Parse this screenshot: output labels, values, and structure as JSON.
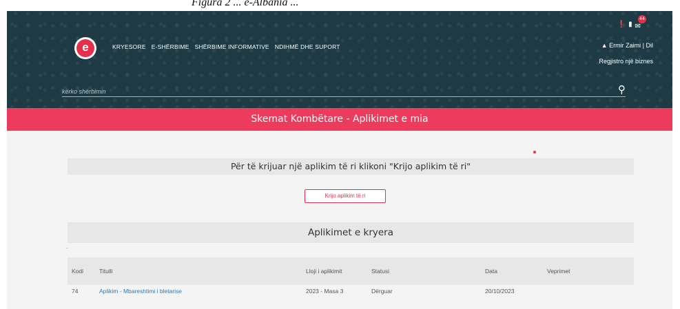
{
  "caption": "Figura 2 ... e-Albania ...",
  "header": {
    "logo_letter": "e",
    "nav": [
      "KRYESORE",
      "E-SHËRBIME",
      "SHËRBIME INFORMATIVE",
      "NDIHMË DHE SUPORT"
    ],
    "notification_count": "44",
    "user_text": "Ermir Zaimi | Dil",
    "register_link": "Regjistro një biznes",
    "search_placeholder": "kërko shërbimin",
    "icons": [
      "notification-icon",
      "bookmark-icon",
      "mail-icon",
      "user-icon",
      "search-icon"
    ]
  },
  "page_title": "Skemat Kombëtare - Aplikimet e mia",
  "instruction": "Për të krijuar një aplikim të ri klikoni \"Krijo aplikim të ri\"",
  "create_button": "Krijo aplikim të ri",
  "results_heading": "Aplikimet e kryera",
  "table": {
    "columns": [
      "Kodi",
      "Titulli",
      "Lloji i aplikimit",
      "Statusi",
      "Data",
      "Veprimet"
    ],
    "rows": [
      [
        "74",
        "Aplikim - Mbareshtimi i bletarise",
        "2023 - Masa 3",
        "Dërguar",
        "20/10/2023",
        ""
      ]
    ]
  },
  "colors": {
    "header_bg": "#1e3b45",
    "accent": "#ec3b5c",
    "link": "#2a7ac0"
  }
}
